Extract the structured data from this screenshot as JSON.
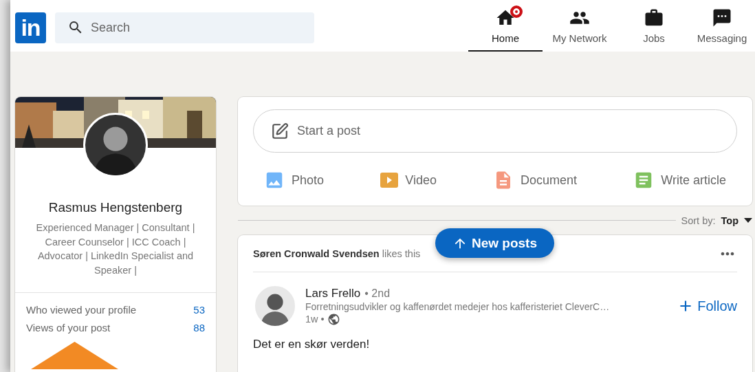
{
  "logo": {
    "text": "in"
  },
  "search": {
    "placeholder": "Search"
  },
  "nav": [
    {
      "label": "Home",
      "kind": "home",
      "selected": true,
      "badge": true
    },
    {
      "label": "My Network",
      "kind": "network",
      "selected": false,
      "badge": false
    },
    {
      "label": "Jobs",
      "kind": "jobs",
      "selected": false,
      "badge": false
    },
    {
      "label": "Messaging",
      "kind": "messaging",
      "selected": false,
      "badge": false
    }
  ],
  "profile": {
    "name": "Rasmus Hengstenberg",
    "headline": "Experienced Manager | Consultant | Career Counselor | ICC Coach | Advocator | LinkedIn Specialist and Speaker |",
    "stats": [
      {
        "label": "Who viewed your profile",
        "value": "53"
      },
      {
        "label": "Views of your post",
        "value": "88"
      }
    ]
  },
  "share": {
    "placeholder": "Start a post",
    "actions": [
      {
        "label": "Photo",
        "color": "#70b5f9"
      },
      {
        "label": "Video",
        "kind": "video",
        "color": "#e7a33e"
      },
      {
        "label": "Document",
        "kind": "document",
        "color": "#f5987e"
      },
      {
        "label": "Write article",
        "kind": "article",
        "color": "#7fc15e"
      }
    ]
  },
  "sort": {
    "label": "Sort by:",
    "value": "Top"
  },
  "new_posts": {
    "label": "New posts"
  },
  "post": {
    "context": "**Søren Cronwald Svendsen** likes this",
    "author": "Lars Frello",
    "degree": "• 2nd",
    "subtitle": "Forretningsudvikler og kaffenørdet medejer hos kafferisteriet CleverC…",
    "time": "1w •",
    "follow": "Follow",
    "text": "Det er en skør verden!"
  }
}
